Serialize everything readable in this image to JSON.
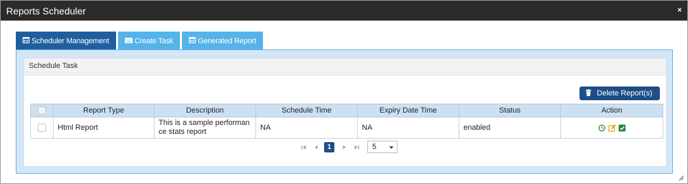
{
  "window": {
    "title": "Reports Scheduler",
    "close_glyph": "×"
  },
  "tabs": [
    {
      "label": "Scheduler Management",
      "icon": "calendar-icon",
      "active": true
    },
    {
      "label": "Create Task",
      "icon": "keyboard-icon",
      "active": false
    },
    {
      "label": "Generated Report",
      "icon": "calendar-icon",
      "active": false
    }
  ],
  "panel": {
    "header": "Schedule Task"
  },
  "toolbar": {
    "delete_label": "Delete Report(s)",
    "delete_icon": "trash-icon"
  },
  "table": {
    "columns": [
      "Report Type",
      "Description",
      "Schedule Time",
      "Expiry Date Time",
      "Status",
      "Action"
    ],
    "rows": [
      {
        "report_type": "Html Report",
        "description_line1": "This is a sample performan",
        "description_line2": "ce stats report",
        "schedule_time": "NA",
        "expiry_date_time": "NA",
        "status": "enabled",
        "actions": [
          "clock-icon",
          "edit-icon",
          "check-icon"
        ]
      }
    ]
  },
  "pager": {
    "current_page": "1",
    "page_size": "5"
  },
  "colors": {
    "titlebar": "#2b2b2b",
    "tab_active": "#1f5fa0",
    "tab_inactive": "#55b3ea",
    "button": "#1d4f86",
    "clock": "#2e9a2e",
    "edit": "#e6a117",
    "check": "#1f8a2e"
  }
}
